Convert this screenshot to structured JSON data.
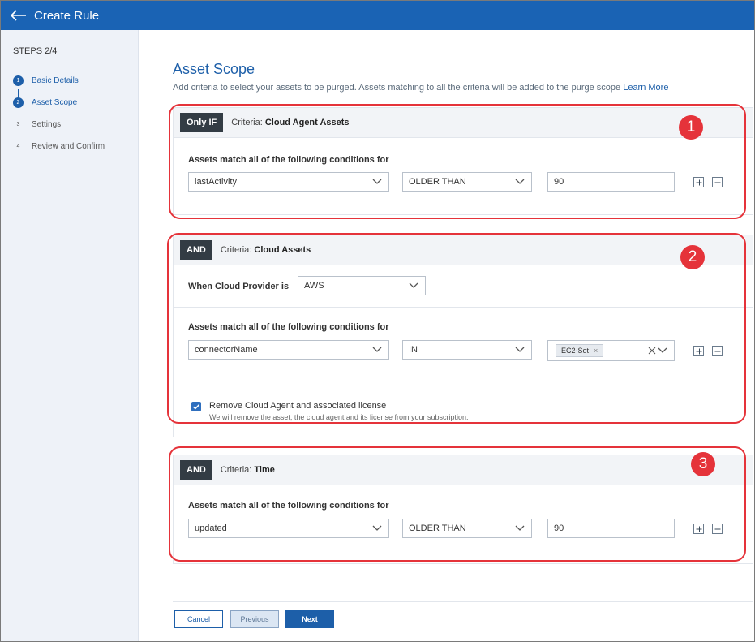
{
  "header": {
    "title": "Create Rule"
  },
  "sidebar": {
    "steps_title": "STEPS 2/4",
    "steps": [
      {
        "num": "1",
        "label": "Basic Details"
      },
      {
        "num": "2",
        "label": "Asset Scope"
      },
      {
        "num": "3",
        "label": "Settings"
      },
      {
        "num": "4",
        "label": "Review and Confirm"
      }
    ]
  },
  "main": {
    "title": "Asset Scope",
    "subtitle": "Add criteria to select your assets to be purged. Assets matching to all the criteria will be added to the purge scope",
    "learn_more": "Learn More"
  },
  "criteria": [
    {
      "badge": "Only IF",
      "criteria_prefix": "Criteria: ",
      "criteria_name": "Cloud Agent Assets",
      "cond_label": "Assets match all of the following conditions for",
      "field": "lastActivity",
      "operator": "OLDER THAN",
      "value": "90",
      "marker": "1"
    },
    {
      "badge": "AND",
      "criteria_prefix": "Criteria: ",
      "criteria_name": "Cloud Assets",
      "provider_label": "When Cloud Provider is",
      "provider_value": "AWS",
      "cond_label": "Assets match all of the following conditions for",
      "field": "connectorName",
      "operator": "IN",
      "chip": "EC2-Sot",
      "checkbox_label": "Remove Cloud Agent and associated license",
      "checkbox_help": "We will remove the asset, the cloud agent and its license from your subscription.",
      "marker": "2"
    },
    {
      "badge": "AND",
      "criteria_prefix": "Criteria: ",
      "criteria_name": "Time",
      "cond_label": "Assets match all of the following conditions for",
      "field": "updated",
      "operator": "OLDER THAN",
      "value": "90",
      "marker": "3"
    }
  ],
  "footer": {
    "cancel": "Cancel",
    "previous": "Previous",
    "next": "Next"
  },
  "colors": {
    "brand": "#1a63b4",
    "annotation": "#e5333a",
    "badge": "#333c44"
  }
}
